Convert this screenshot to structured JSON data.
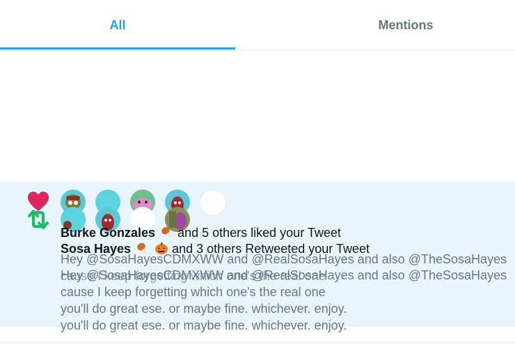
{
  "tabs": [
    {
      "label": "All",
      "active": true
    },
    {
      "label": "Mentions",
      "active": false
    }
  ],
  "notification": {
    "likes": {
      "name": "Burke Gonzales",
      "rest": "and 5 others liked your Tweet"
    },
    "retweets": {
      "name": "Sosa Hayes",
      "rest": "and 3 others Retweeted your Tweet"
    },
    "tweet_text_lines": [
      "Hey @SosaHayesCDMXWW and @RealSosaHayes and also @TheSosaHayes",
      "Hey @SosaHayesCDMXWW and @RealSosaHayes and also @TheSosaHayes",
      "cause I keep forgetting which one's the real one",
      "cause I keep forgetting which one's the real one",
      "you'll do great ese. or maybe fine. whichever. enjoy.",
      "you'll do great ese. or maybe fine. whichever. enjoy."
    ],
    "icons": {
      "like": "heart-icon",
      "retweet": "retweet-icon"
    },
    "colors": {
      "like": "#e0245e",
      "retweet": "#17bf63",
      "accent": "#1da1f2",
      "highlight_bg": "#e8f5fd"
    }
  }
}
